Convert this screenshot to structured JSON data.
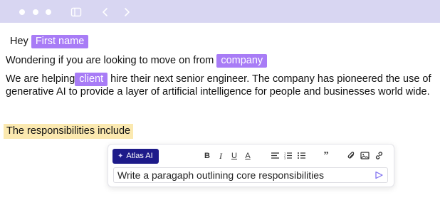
{
  "window": {
    "controls": [
      "close-dot",
      "minimize-dot",
      "maximize-dot"
    ],
    "toolbar_icons": [
      "sidebar-toggle-icon",
      "back-arrow-icon",
      "forward-arrow-icon"
    ]
  },
  "email": {
    "greeting": "Hey",
    "greeting_tag": "First name",
    "line2_text": "Wondering if you are looking to move on from",
    "line2_tag": "company",
    "para_prefix": "We are helping",
    "para_tag": "client",
    "para_rest": "hire their next senior engineer. The company has pioneered the use of generative AI to provide a layer of artificial intelligence for people and businesses world wide.",
    "highlight_text": "The responsibilities include"
  },
  "ai_panel": {
    "button_label": "Atlas AI",
    "tools": {
      "bold": "B",
      "italic": "I",
      "underline": "U",
      "text_color": "A",
      "quote": "”"
    },
    "tool_icons": [
      "bold-icon",
      "italic-icon",
      "underline-icon",
      "text-color-icon",
      "align-icon",
      "ordered-list-icon",
      "bullet-list-icon",
      "quote-icon",
      "attachment-icon",
      "image-icon",
      "link-icon"
    ],
    "prompt_value": "Write a paragaph outlining core responsibilities",
    "send_icon": "send-icon"
  },
  "colors": {
    "titlebar": "#d8d6f2",
    "tag": "#a87cf6",
    "highlight": "#fbe9b0",
    "atlas_button": "#1e1b8a",
    "send": "#7b6cf0"
  }
}
